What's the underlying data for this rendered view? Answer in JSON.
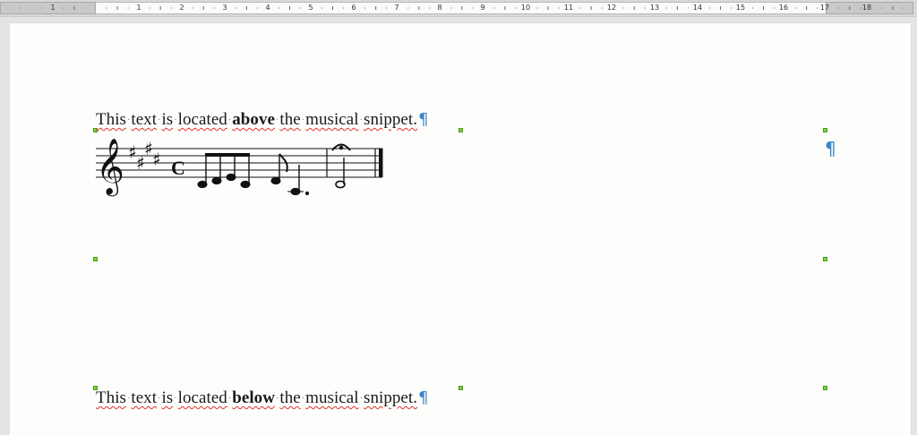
{
  "ruler": {
    "numbers": [
      "1",
      "1",
      "2",
      "3",
      "4",
      "5",
      "6",
      "7",
      "8",
      "9",
      "10",
      "11",
      "12",
      "13",
      "14",
      "15",
      "16",
      "17",
      "18"
    ]
  },
  "document": {
    "para_above": {
      "words": [
        "This",
        "text",
        "is",
        "located",
        "above",
        "the",
        "musical",
        "snippet."
      ],
      "bold_index": 4
    },
    "para_below": {
      "words": [
        "This",
        "text",
        "is",
        "located",
        "below",
        "the",
        "musical",
        "snippet."
      ],
      "bold_index": 4
    },
    "pilcrow": "¶",
    "space_marker": "·"
  },
  "music": {
    "clef": "treble",
    "key_signature_sharps": 4,
    "time_signature": "C",
    "fermata": true
  },
  "colors": {
    "pilcrow": "#3d86c6",
    "handle": "#7cd23c",
    "spellcheck": "#e0302a"
  }
}
